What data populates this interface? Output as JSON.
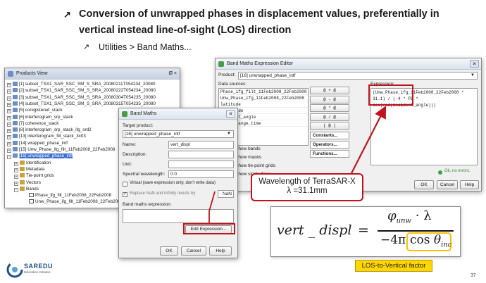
{
  "slide": {
    "bullet_main": "Conversion of unwrapped phases in displacement values, preferentially in vertical instead line-of-sight (LOS) direction",
    "bullet_main_line1": "Conversion of unwrapped phases in displacement values, preferentially in",
    "bullet_main_line2": "vertical instead line-of-sight (LOS) direction",
    "bullet_sub": "Utilities > Band Maths...",
    "page_number": "37",
    "logo_text": "SAREDU",
    "logo_sub": "Education Initiative",
    "colors": {
      "highlight_yellow": "#ffd700",
      "arrow_red": "#c0141e",
      "selection_blue": "#3c6fd1"
    }
  },
  "products_view": {
    "title": "Products View",
    "title_controls": "Ø ×",
    "items": [
      "[1] subset_TSX1_SAR_SSC_SM_S_SRA_20080211T054234_20080",
      "[2] subset_TSX1_SAR_SSC_SM_S_SRA_20080222T054234_20080",
      "[3] subset_TSX1_SAR_SSC_SM_S_SRA_20080304T054235_20080",
      "[4] subset_TSX1_SAR_SSC_SM_S_SRA_20080315T054235_20080",
      "[5] coregistered_stack",
      "[6] interferogram_srp_stack",
      "[7] coherence_stack",
      "[8] interferogram_srp_stack_ifg_srd2",
      "[13] interferogram_filt_stack_3x03",
      "[14] wrapped_phase_intf",
      "[15] Unw_Phase_ifg_filt_11Feb2008_22Feb2008",
      "[16] unwrapped_phase_intf"
    ],
    "children": [
      "Identification",
      "Metadata",
      "Tie-point grids",
      "Vectors",
      "Bands"
    ],
    "bands": [
      "Phase_ifg_filt_11Feb2008_22Feb2008",
      "Unw_Phase_ifg_filt_11Feb2008_22Feb2008"
    ]
  },
  "expr_editor": {
    "title": "Band Maths Expression Editor",
    "product_label": "Product:",
    "product_value": "[16] unwrapped_phase_intf",
    "sources_label": "Data sources:",
    "sources": [
      "Phase_ifg_filt_11Feb2008_22Feb2008",
      "Unw_Phase_ifg_11Feb2008_22Feb2008",
      "latitude",
      "longitude",
      "incident_angle",
      "slant_range_time"
    ],
    "show_bands": "Show bands",
    "show_masks": "Show masks",
    "show_tiepoints": "Show tie-point grids",
    "show_single": "Show single flags",
    "ops": [
      "@ + @",
      "@ - @",
      "@ * @",
      "@ / @",
      "( @ )"
    ],
    "constants": "Constants...",
    "operators": "Operators...",
    "functions": "Functions...",
    "expression_label": "Expression:",
    "expression_lines": [
      "(Unw_Phase_ifg_11Feb2008_22Feb2008 *",
      " 31.1) / (-4 * PI *",
      "cos(rad(incident_angle)))"
    ],
    "status_ok": "Ok, no errors.",
    "ok": "OK",
    "cancel": "Cancel",
    "help": "Help"
  },
  "band_maths": {
    "title": "Band Maths",
    "target_label": "Target product:",
    "target_value": "[16] unwrapped_phase_intf",
    "name_label": "Name:",
    "name_value": "vert_displ",
    "description_label": "Description:",
    "description_value": "",
    "unit_label": "Unit:",
    "unit_value": "",
    "spectral_label": "Spectral wavelength:",
    "spectral_value": "0.0",
    "virtual_label": "Virtual (save expression only, don't write data)",
    "replace_label": "Replace NaN and infinity results by",
    "replace_value": "NaN",
    "expr_label": "Band maths expression:",
    "edit_expr": "Edit Expression...",
    "ok": "OK",
    "cancel": "Cancel",
    "help": "Help"
  },
  "annotations": {
    "wavelength_title": "Wavelength of TerraSAR-X",
    "wavelength_value": "λ =31.1mm",
    "formula_lhs": "vert _ displ",
    "formula_equals": "=",
    "formula_num_phi": "φ",
    "formula_num_sub": "unw",
    "formula_num_rest": "· λ",
    "formula_den_pre": "−4π ·",
    "formula_den_cos": "cos",
    "formula_den_theta": "θ",
    "formula_den_sub": "inc",
    "los_label": "LOS-to-Vertical factor"
  }
}
